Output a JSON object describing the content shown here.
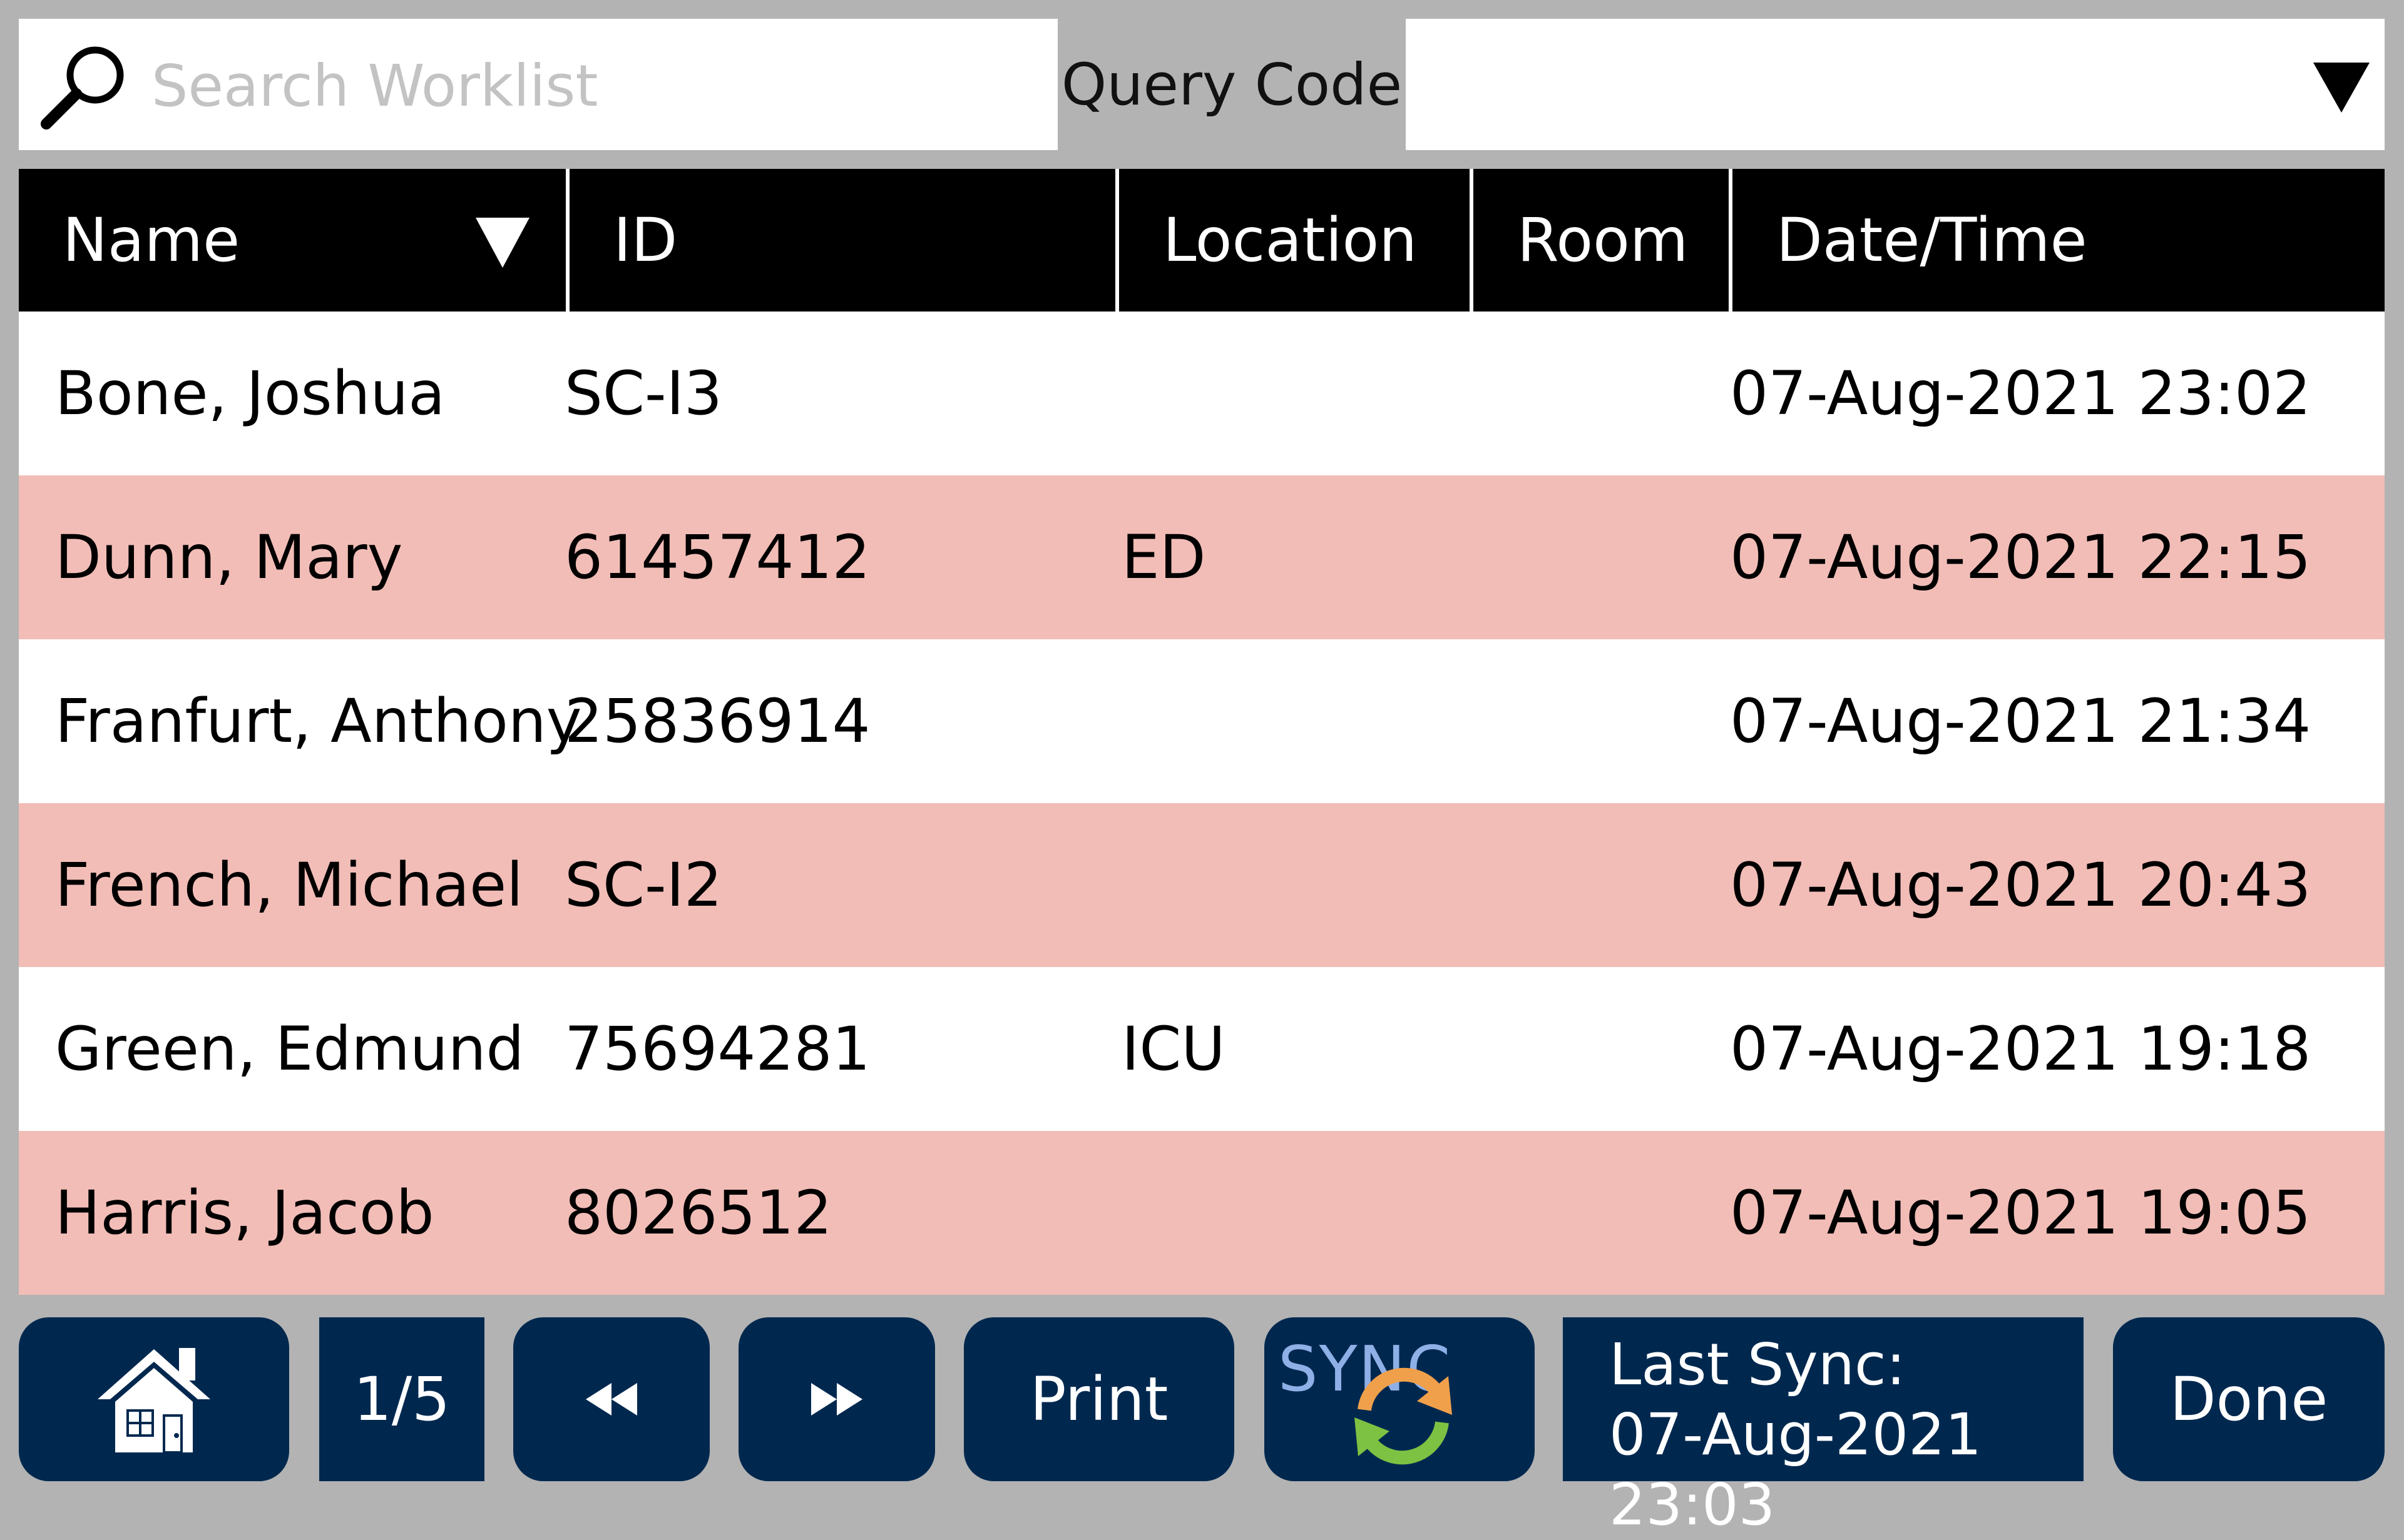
{
  "search": {
    "placeholder": "Search Worklist"
  },
  "query": {
    "label": "Query Code",
    "selected": ""
  },
  "table": {
    "columns": [
      "Name",
      "ID",
      "Location",
      "Room",
      "Date/Time"
    ],
    "rows": [
      {
        "name": "Bone, Joshua",
        "id": "SC-I3",
        "location": "",
        "room": "",
        "datetime": "07-Aug-2021 23:02"
      },
      {
        "name": "Dunn, Mary",
        "id": "61457412",
        "location": "ED",
        "room": "",
        "datetime": "07-Aug-2021 22:15"
      },
      {
        "name": "Franfurt, Anthony",
        "id": "25836914",
        "location": "",
        "room": "",
        "datetime": "07-Aug-2021 21:34"
      },
      {
        "name": "French, Michael",
        "id": "SC-I2",
        "location": "",
        "room": "",
        "datetime": "07-Aug-2021 20:43"
      },
      {
        "name": "Green, Edmund",
        "id": "75694281",
        "location": "ICU",
        "room": "",
        "datetime": "07-Aug-2021 19:18"
      },
      {
        "name": "Harris, Jacob",
        "id": "8026512",
        "location": "",
        "room": "",
        "datetime": "07-Aug-2021 19:05"
      }
    ]
  },
  "toolbar": {
    "page": "1/5",
    "print_label": "Print",
    "sync_label": "SYNC",
    "last_sync_label": "Last Sync:",
    "last_sync_time": "07-Aug-2021 23:03",
    "done_label": "Done"
  },
  "icons": {
    "search": "search-icon",
    "sort": "sort-down-icon",
    "dropdown": "chevron-down-icon",
    "home": "home-icon",
    "prev": "rewind-icon",
    "next": "fast-forward-icon",
    "sync": "sync-icon"
  },
  "colors": {
    "background": "#b3b3b3",
    "header": "#000000",
    "row_alt": "#f2bdb7",
    "button": "#00284f",
    "sync_orange": "#f0a04b",
    "sync_green": "#7dc242"
  }
}
